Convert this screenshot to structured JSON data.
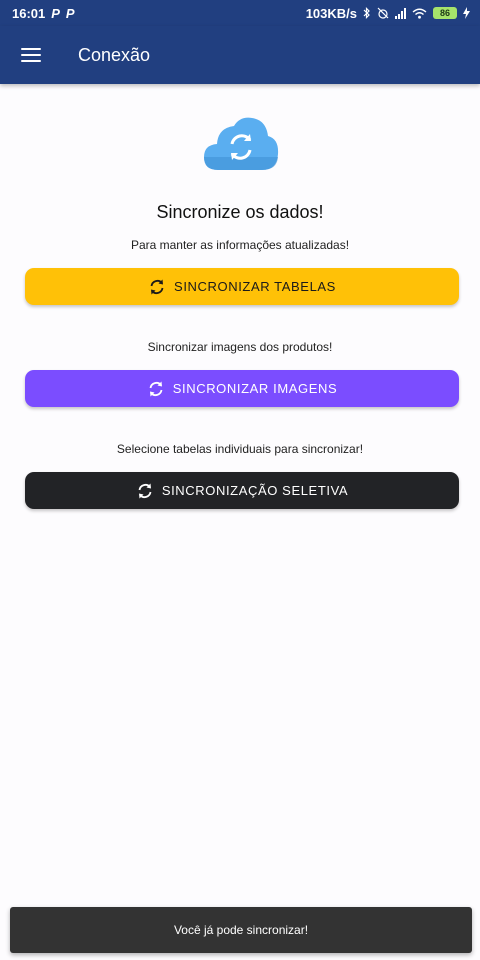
{
  "status_bar": {
    "time": "16:01",
    "notification_icons": [
      "P",
      "P"
    ],
    "net_speed": "103KB/s",
    "battery_level": "86"
  },
  "app_bar": {
    "title": "Conexão",
    "menu_icon": "hamburger-icon",
    "color": "#213f80"
  },
  "main": {
    "cloud_icon": "cloud-sync-icon",
    "headline": "Sincronize os dados!",
    "sections": [
      {
        "description": "Para manter as informações atualizadas!",
        "button_label": "SINCRONIZAR TABELAS",
        "button_color": "#ffc107",
        "icon": "sync-icon"
      },
      {
        "description": "Sincronizar imagens dos produtos!",
        "button_label": "SINCRONIZAR IMAGENS",
        "button_color": "#7b4dff",
        "icon": "sync-icon"
      },
      {
        "description": "Selecione tabelas individuais para sincronizar!",
        "button_label": "SINCRONIZAÇÃO SELETIVA",
        "button_color": "#222326",
        "icon": "sync-icon"
      }
    ]
  },
  "snackbar": {
    "message": "Você já pode sincronizar!"
  }
}
